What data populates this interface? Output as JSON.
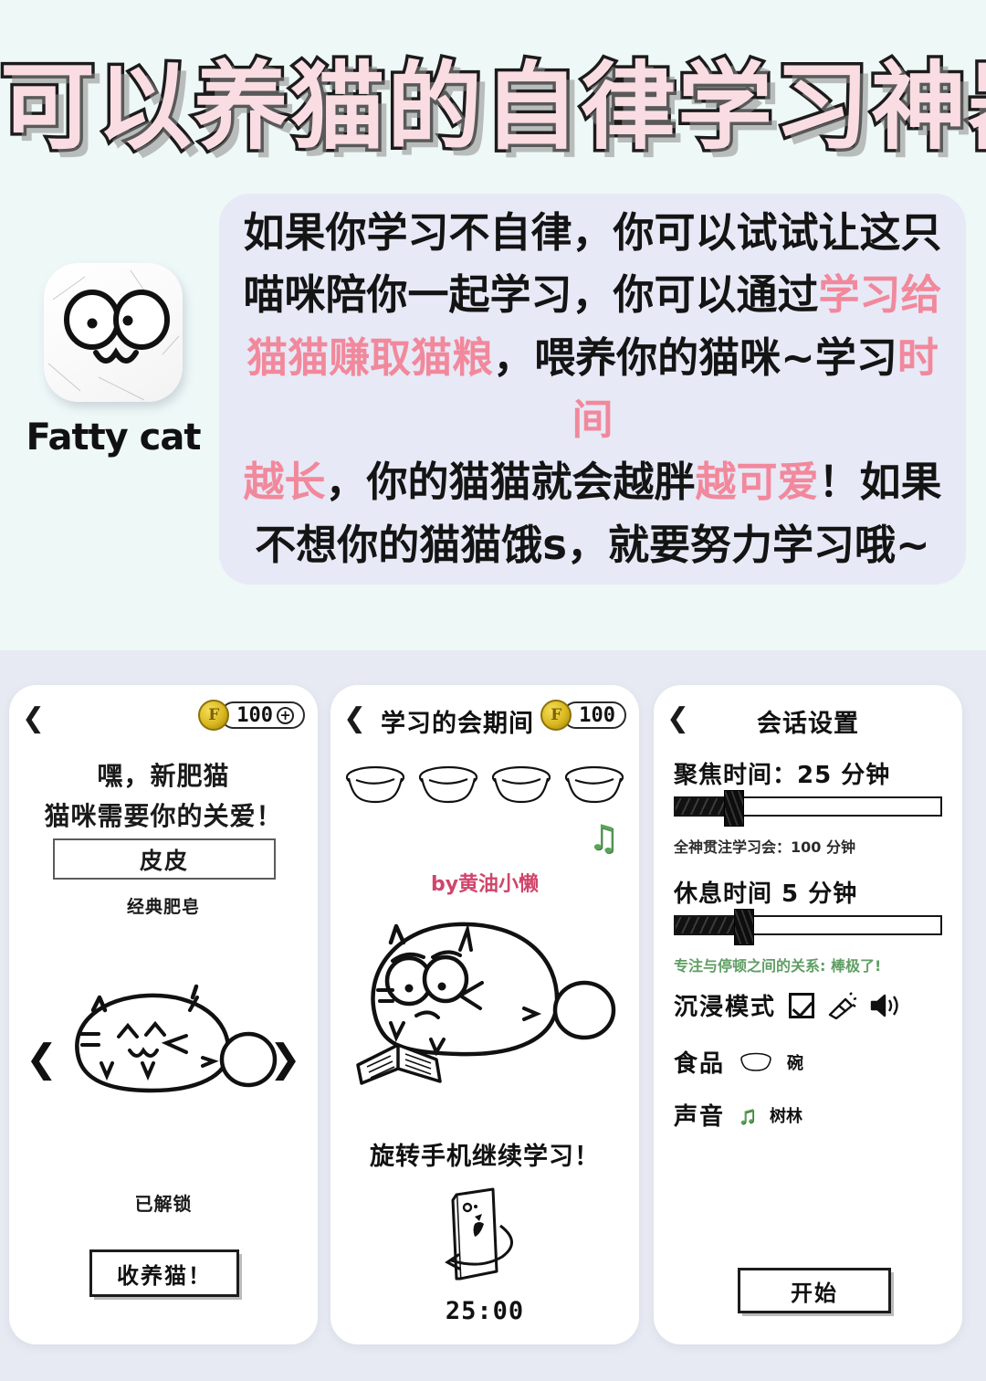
{
  "promo": {
    "title": "可以养猫的自律学习神器",
    "app": {
      "name": "Fatty cat",
      "icon": "cat-face-icon"
    },
    "description": {
      "lines": [
        [
          {
            "t": "如果你学习不自律，你可以试试让这只",
            "h": false
          }
        ],
        [
          {
            "t": "喵咪陪你一起学习，你可以通过",
            "h": false
          },
          {
            "t": "学习给",
            "h": true
          }
        ],
        [
          {
            "t": "猫猫赚取猫粮",
            "h": true
          },
          {
            "t": "，喂养你的猫咪~学习",
            "h": false
          },
          {
            "t": "时间",
            "h": true
          }
        ],
        [
          {
            "t": "越长",
            "h": true
          },
          {
            "t": "，你的猫猫就会越胖",
            "h": false
          },
          {
            "t": "越可爱",
            "h": true
          },
          {
            "t": "！如果",
            "h": false
          }
        ],
        [
          {
            "t": "不想你的猫猫饿s，就要努力学习哦~",
            "h": false
          }
        ]
      ]
    },
    "colors": {
      "background": "#eef8f7",
      "title_fill": "#fadde3",
      "title_outline": "#1b1b1b",
      "highlight": "#f2889c",
      "card_bg": "#e7e9f6"
    }
  },
  "strip": {
    "background": "#e7eaf3"
  },
  "screens": [
    {
      "id": "adopt-cat",
      "back_icon": "back-chevron-icon",
      "coins": {
        "icon": "coin-icon",
        "letter": "F",
        "amount": "100",
        "add_icon": "plus-circle-icon"
      },
      "heading": "嘿，新肥猫",
      "subheading": "猫咪需要你的关爱！",
      "name_value": "皮皮",
      "name_placeholder": "皮皮",
      "breed": "经典肥皂",
      "prev_icon": "chevron-left-icon",
      "next_icon": "chevron-right-icon",
      "cat_art": "fat-cat-sleeping-icon",
      "status": "已解锁",
      "action_label": "收养猫！"
    },
    {
      "id": "study-session",
      "back_icon": "back-chevron-icon",
      "title": "学习的会期间",
      "coins": {
        "icon": "coin-icon",
        "letter": "F",
        "amount": "100"
      },
      "bowls_count": 4,
      "bowl_icon": "food-bowl-icon",
      "music_icon": "music-note-icon",
      "music_color": "#5aa35a",
      "watermark": "by黄油小懒",
      "watermark_color": "#d1456b",
      "cat_art": "fat-cat-reading-icon",
      "rotate_hint": "旋转手机继续学习！",
      "phone_icon": "rotate-phone-icon",
      "timer": "25:00"
    },
    {
      "id": "session-settings",
      "back_icon": "back-chevron-icon",
      "title": "会话设置",
      "focus": {
        "label": "聚焦时间：25 分钟",
        "slider_percent": 22,
        "note": "全神贯注学习会：100 分钟"
      },
      "rest": {
        "label": "休息时间 5 分钟",
        "slider_percent": 26,
        "note": "专注与停顿之间的关系: 棒极了!",
        "note_color": "#5f9e63"
      },
      "immersive": {
        "label": "沉浸模式",
        "checked": true,
        "checkbox_icon": "checkbox-checked-icon",
        "flashlight_icon": "flashlight-icon",
        "speaker_icon": "speaker-icon"
      },
      "food": {
        "label": "食品",
        "icon": "food-bowl-icon",
        "value": "碗"
      },
      "sound": {
        "label": "声音",
        "icon": "music-note-icon",
        "value": "树林"
      },
      "action_label": "开始"
    }
  ]
}
